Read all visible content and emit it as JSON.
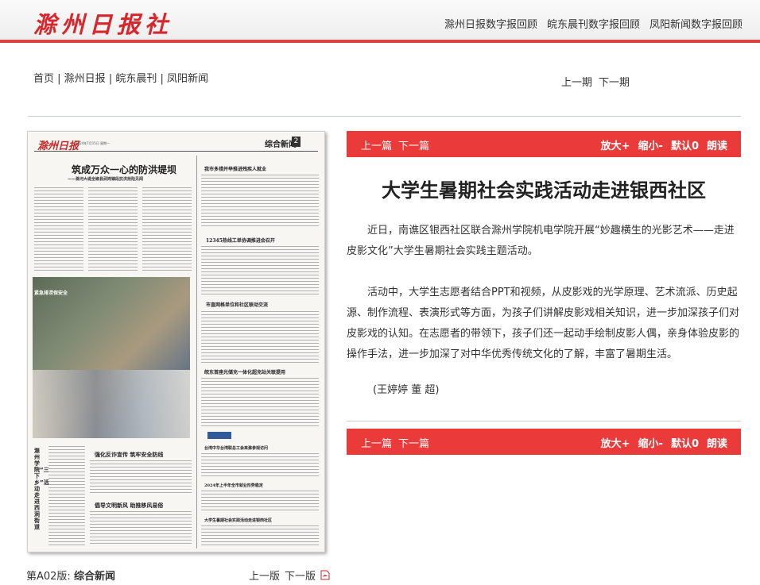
{
  "header": {
    "logo": "滁州日报社",
    "links": [
      "滁州日报数字报回顾",
      "皖东晨刊数字报回顾",
      "凤阳新闻数字报回顾"
    ]
  },
  "nav": {
    "items": [
      "首页",
      "滁州日报",
      "皖东晨刊",
      "凤阳新闻"
    ],
    "issue_prev": "上一期",
    "issue_next": "下一期"
  },
  "page": {
    "label": "第A02版:",
    "section": "综合新闻",
    "prev": "上一版",
    "next": "下一版"
  },
  "newspaper": {
    "masthead": "滁州日报",
    "date_line": "2024年7月15日 星期一",
    "section": "综合新闻",
    "page_no": "2",
    "headline": "筑成万众一心的防洪堤坝",
    "subhead": "——滁河大堤全椒县武岗镇段抗洪抢险见闻",
    "photo_caption": "紧急排涝保安全",
    "vertical_headline": "滁州学院“三下乡”活动走进西涧街道",
    "h_right1": "我市多措并举推进残疾人就业",
    "h_right2": "12345热线工单协调推进会召开",
    "h_right3": "市直网格单位和社区联动交流",
    "h_right4": "皖东首座光储充一体化超充站关联提用",
    "h_bottom1": "强化反诈宣传 筑牢安全防线",
    "h_bottom2": "倡导文明新风 助推移风易俗",
    "h_small1": "台湾中华台湾联总工会来滁参观访问",
    "h_small2": "2024年上半年全市就业形势稳定",
    "h_small3": "大学生暑期社会实践活动走进银西社区"
  },
  "article": {
    "bar": {
      "prev": "上一篇",
      "next": "下一篇",
      "zoom_in": "放大+",
      "zoom_out": "缩小-",
      "default": "默认0",
      "read": "朗读"
    },
    "title": "大学生暑期社会实践活动走进银西社区",
    "paragraphs": [
      "近日，南谯区银西社区联合滁州学院机电学院开展“妙趣横生的光影艺术——走进皮影文化”大学生暑期社会实践主题活动。",
      "活动中，大学生志愿者结合PPT和视频，从皮影戏的光学原理、艺术流派、历史起源、制作流程、表演形式等方面，为孩子们讲解皮影戏相关知识，进一步加深孩子们对皮影戏的认知。在志愿者的带领下，孩子们还一起动手绘制皮影人偶，亲身体验皮影的操作手法，进一步加深了对中华优秀传统文化的了解，丰富了暑期生活。"
    ],
    "byline": "(王婷婷 董 超)"
  },
  "colors": {
    "accent": "#ea3a3a",
    "logo": "#d8262d"
  }
}
